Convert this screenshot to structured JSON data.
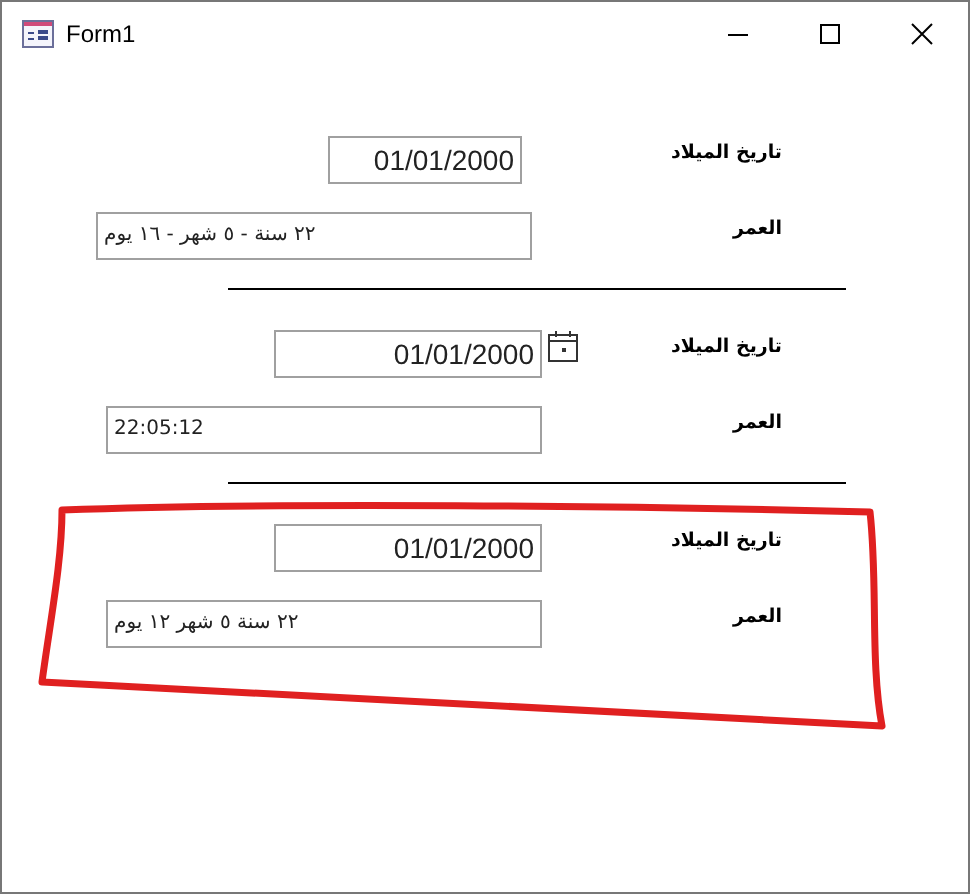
{
  "window": {
    "title": "Form1"
  },
  "sections": [
    {
      "annotated": false,
      "fields": [
        {
          "kind": "date",
          "label": "تاريخ الميلاد",
          "value": "01/01/2000",
          "calendar_button": false
        },
        {
          "kind": "age",
          "label": "العمر",
          "value": "٢٢ سنة - ٥ شهر - ١٦ يوم"
        }
      ]
    },
    {
      "annotated": false,
      "fields": [
        {
          "kind": "date",
          "label": "تاريخ الميلاد",
          "value": "01/01/2000",
          "calendar_button": true
        },
        {
          "kind": "age",
          "label": "العمر",
          "value": "22:05:12"
        }
      ]
    },
    {
      "annotated": true,
      "fields": [
        {
          "kind": "date",
          "label": "تاريخ الميلاد",
          "value": "01/01/2000",
          "calendar_button": false
        },
        {
          "kind": "age",
          "label": "العمر",
          "value": "٢٢ سنة ٥ شهر ١٢ يوم"
        }
      ]
    }
  ]
}
